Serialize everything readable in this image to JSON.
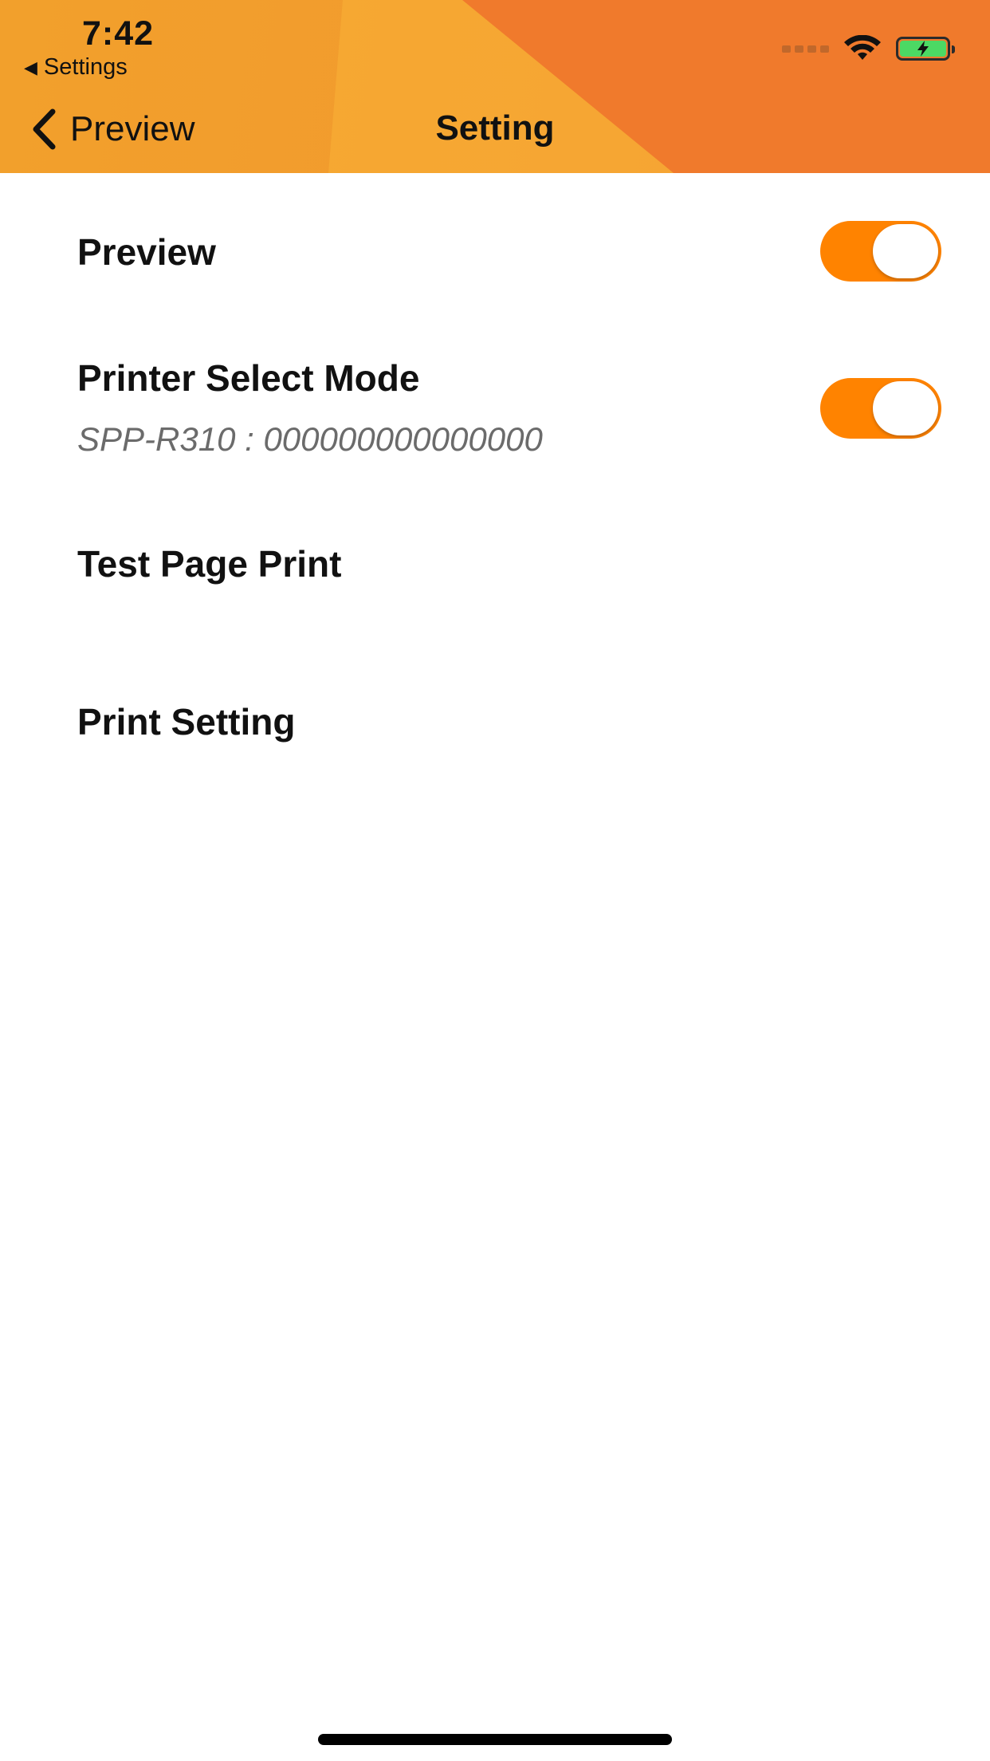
{
  "status_bar": {
    "time": "7:42",
    "back_app": "Settings",
    "back_arrow": "◀"
  },
  "nav": {
    "back_label": "Preview",
    "title": "Setting"
  },
  "settings": {
    "preview": {
      "label": "Preview",
      "toggle_on": true
    },
    "printer_select_mode": {
      "label": "Printer Select Mode",
      "subtitle": "SPP-R310 : 000000000000000",
      "toggle_on": true
    },
    "test_page_print": {
      "label": "Test Page Print"
    },
    "print_setting": {
      "label": "Print Setting"
    }
  },
  "colors": {
    "accent": "#FF8300",
    "header_orange": "#F07A2C",
    "header_yellow": "#F2A02C",
    "battery_green": "#4CD964"
  },
  "icons": [
    "wifi-icon",
    "battery-charging-icon",
    "chevron-left-icon"
  ]
}
